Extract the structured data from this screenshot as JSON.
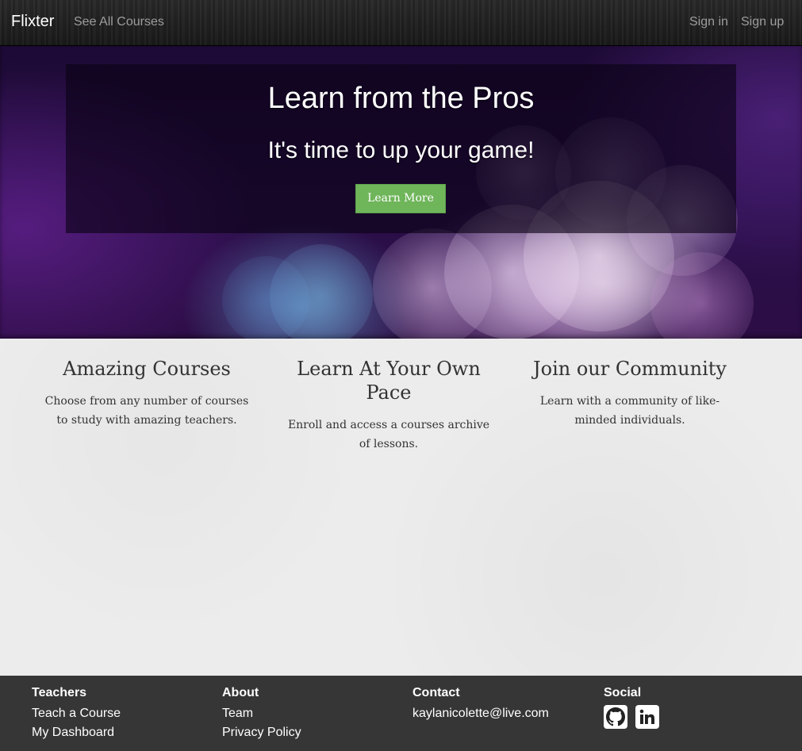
{
  "navbar": {
    "brand": "Flixter",
    "see_all_courses": "See All Courses",
    "sign_in": "Sign in",
    "sign_up": "Sign up"
  },
  "hero": {
    "title": "Learn from the Pros",
    "subtitle": "It's time to up your game!",
    "button_label": "Learn More"
  },
  "features": [
    {
      "title": "Amazing Courses",
      "text": "Choose from any number of courses to study with amazing teachers."
    },
    {
      "title": "Learn At Your Own Pace",
      "text": "Enroll and access a courses archive of lessons."
    },
    {
      "title": "Join our Community",
      "text": "Learn with a community of like-minded individuals."
    }
  ],
  "footer": {
    "teachers": {
      "heading": "Teachers",
      "links": [
        "Teach a Course",
        "My Dashboard"
      ]
    },
    "about": {
      "heading": "About",
      "links": [
        "Team",
        "Privacy Policy"
      ]
    },
    "contact": {
      "heading": "Contact",
      "email": "kaylanicolette@live.com"
    },
    "social": {
      "heading": "Social",
      "icons": [
        "github-icon",
        "linkedin-icon"
      ]
    }
  },
  "colors": {
    "navbar_bg": "#222222",
    "hero_button": "#6fb55a",
    "footer_bg": "#363636",
    "page_bg": "#ececec"
  }
}
